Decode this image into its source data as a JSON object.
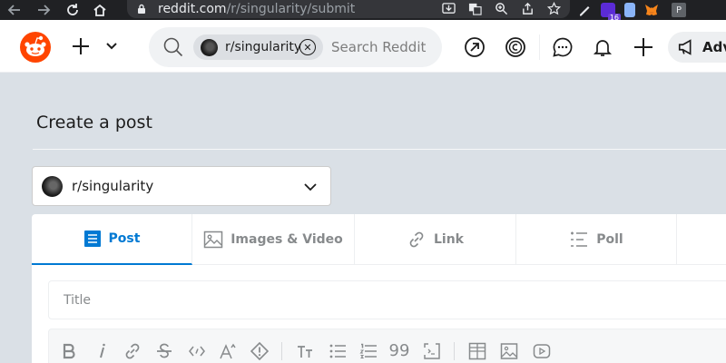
{
  "browser": {
    "url_host": "reddit.com",
    "url_path": "/r/singularity/submit",
    "extension_badge": "16",
    "profile_initial": "P"
  },
  "header": {
    "search_chip": "r/singularity",
    "search_placeholder": "Search Reddit",
    "advertise_label": "Adv"
  },
  "page": {
    "title": "Create a post",
    "community": "r/singularity"
  },
  "tabs": [
    {
      "label": "Post",
      "icon": "document-icon",
      "active": true
    },
    {
      "label": "Images & Video",
      "icon": "image-icon",
      "active": false
    },
    {
      "label": "Link",
      "icon": "link-icon",
      "active": false
    },
    {
      "label": "Poll",
      "icon": "poll-icon",
      "active": false
    }
  ],
  "editor": {
    "title_placeholder": "Title",
    "quote_glyph": "99"
  },
  "colors": {
    "reddit_orange": "#ff4500",
    "active_blue": "#0079d3",
    "page_bg": "#dae0e6"
  }
}
